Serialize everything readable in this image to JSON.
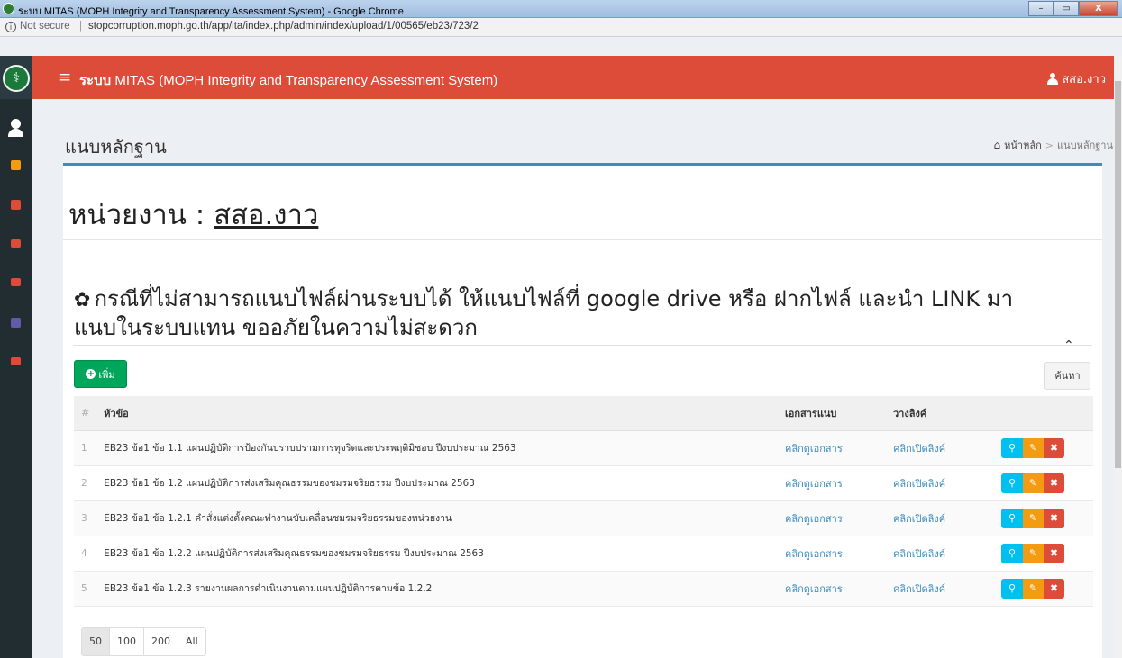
{
  "window": {
    "title": "ระบบ MITAS (MOPH Integrity and Transparency Assessment System) - Google Chrome",
    "minimize": "–",
    "maximize": "▭",
    "close": "X"
  },
  "address_bar": {
    "info": "i",
    "not_secure": "Not secure",
    "separator": "|",
    "url": "stopcorruption.moph.go.th/app/ita/index.php/admin/index/upload/1/00565/eb23/723/2"
  },
  "header": {
    "menu_toggle": "≡",
    "app_title_bold": "ระบบ",
    "app_title_rest": " MITAS (MOPH Integrity and Transparency Assessment System)",
    "user_name": "สสอ.งาว"
  },
  "page": {
    "title": "แนบหลักฐาน",
    "breadcrumb": {
      "home": "หน้าหลัก",
      "separator": ">",
      "current": "แนบหลักฐาน"
    }
  },
  "unit": {
    "label": "หน่วยงาน : ",
    "name": "สสอ.งาว"
  },
  "notice": {
    "text": "กรณีที่ไม่สามารถแนบไฟล์ผ่านระบบได้ ให้แนบไฟล์ที่ google drive หรือ ฝากไฟล์ และนำ LINK มา แนบในระบบแทน ขออภัยในความไม่สะดวก"
  },
  "toolbar": {
    "add_label": "เพิ่ม",
    "search_label": "ค้นหา"
  },
  "table": {
    "headers": {
      "num": "#",
      "topic": "หัวข้อ",
      "doc": "เอกสารแนบ",
      "link": "วางลิงค์"
    },
    "rows": [
      {
        "num": "1",
        "topic": "EB23 ข้อ1 ข้อ 1.1 แผนปฏิบัติการป้องกันปราบปรามการทุจริตและประพฤติมิชอบ ปีงบประมาณ 2563",
        "doc": "คลิกดูเอกสาร",
        "link": "คลิกเปิดลิงค์"
      },
      {
        "num": "2",
        "topic": "EB23 ข้อ1 ข้อ 1.2 แผนปฏิบัติการส่งเสริมคุณธรรมของชมรมจริยธรรม ปีงบประมาณ 2563",
        "doc": "คลิกดูเอกสาร",
        "link": "คลิกเปิดลิงค์"
      },
      {
        "num": "3",
        "topic": "EB23 ข้อ1 ข้อ 1.2.1 คำสั่งแต่งตั้งคณะทำงานขับเคลื่อนชมรมจริยธรรมของหน่วยงาน",
        "doc": "คลิกดูเอกสาร",
        "link": "คลิกเปิดลิงค์"
      },
      {
        "num": "4",
        "topic": "EB23 ข้อ1 ข้อ 1.2.2 แผนปฏิบัติการส่งเสริมคุณธรรมของชมรมจริยธรรม ปีงบประมาณ 2563",
        "doc": "คลิกดูเอกสาร",
        "link": "คลิกเปิดลิงค์"
      },
      {
        "num": "5",
        "topic": "EB23 ข้อ1 ข้อ 1.2.3 รายงานผลการดำเนินงานตามแผนปฏิบัติการตามข้อ 1.2.2",
        "doc": "คลิกดูเอกสาร",
        "link": "คลิกเปิดลิงค์"
      }
    ]
  },
  "pagination": {
    "sizes": [
      "50",
      "100",
      "200",
      "All"
    ],
    "selected": "50"
  },
  "colors": {
    "header": "#dd4b39",
    "sidebar": "#222d32",
    "add_button": "#00a65a",
    "view_button": "#00c0ef",
    "edit_button": "#f39c12",
    "delete_button": "#dd4b39",
    "link": "#3c8dbc"
  },
  "icons": {
    "sidebar": [
      "user-icon",
      "calendar-icon",
      "document-icon",
      "chart-icon",
      "chart-icon",
      "book-icon",
      "sign-out-icon"
    ],
    "row_actions": [
      "search-icon",
      "edit-icon",
      "delete-icon"
    ]
  }
}
